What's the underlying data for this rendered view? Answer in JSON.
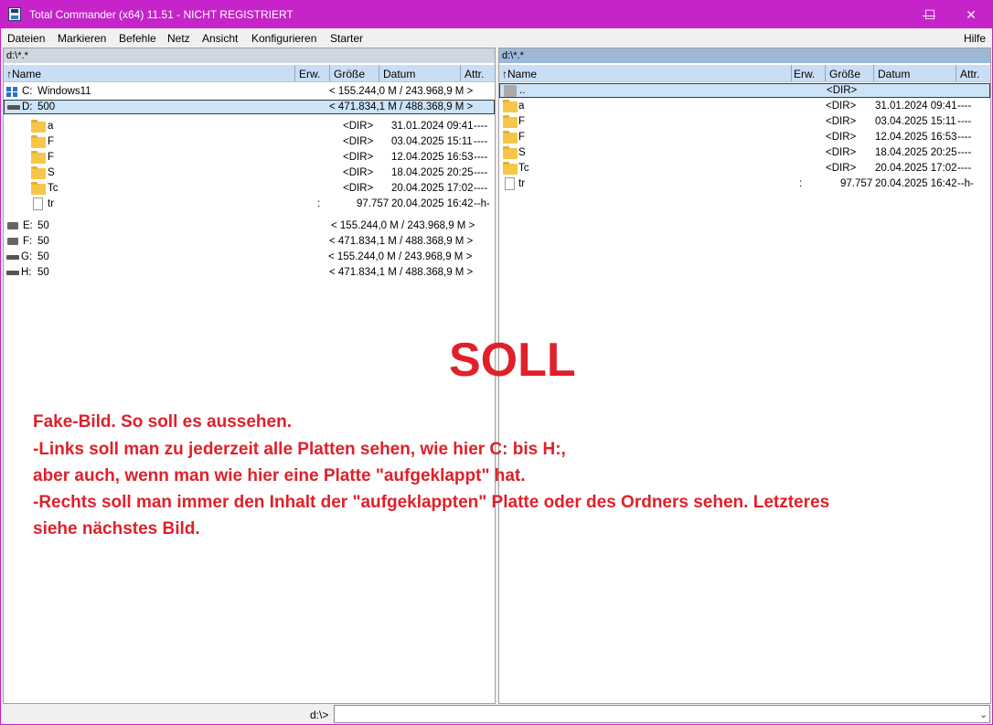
{
  "window": {
    "title": "Total Commander (x64) 11.51 - NICHT REGISTRIERT"
  },
  "titlebar": {
    "minimize": "—",
    "maximize": "☐",
    "close": "✕"
  },
  "menu": [
    "Dateien",
    "Markieren",
    "Befehle",
    "Netz",
    "Ansicht",
    "Konfigurieren",
    "Starter"
  ],
  "menu_help": "Hilfe",
  "left": {
    "path": "d:\\*.*",
    "headers": {
      "name": "↑Name",
      "ext": "Erw.",
      "size": "Größe",
      "date": "Datum",
      "attr": "Attr."
    },
    "drives": [
      {
        "letter": "C:",
        "label": "Windows11",
        "size": "< 155.244,0 M / 243.968,9 M >"
      },
      {
        "letter": "D:",
        "label": "500",
        "size": "< 471.834,1 M / 488.368,9 M >"
      }
    ],
    "files": [
      {
        "name": "a",
        "size": "<DIR>",
        "date": "31.01.2024 09:41",
        "attr": "----"
      },
      {
        "name": "F",
        "size": "<DIR>",
        "date": "03.04.2025 15:11",
        "attr": "----"
      },
      {
        "name": "F",
        "size": "<DIR>",
        "date": "12.04.2025 16:53",
        "attr": "----"
      },
      {
        "name": "S",
        "size": "<DIR>",
        "date": "18.04.2025 20:25",
        "attr": "----"
      },
      {
        "name": "Tc",
        "size": "<DIR>",
        "date": "20.04.2025 17:02",
        "attr": "----"
      },
      {
        "name": "tr",
        "ext": ":",
        "size": "97.757",
        "date": "20.04.2025 16:42",
        "attr": "--h-"
      }
    ],
    "drives2": [
      {
        "letter": "E:",
        "label": "50",
        "size": "< 155.244,0 M / 243.968,9 M >"
      },
      {
        "letter": "F:",
        "label": "50",
        "size": "< 471.834,1 M / 488.368,9 M >"
      },
      {
        "letter": "G:",
        "label": "50",
        "size": "< 155.244,0 M / 243.968,9 M >"
      },
      {
        "letter": "H:",
        "label": "50",
        "size": "< 471.834,1 M / 488.368,9 M >"
      }
    ]
  },
  "right": {
    "path": "d:\\*.*",
    "headers": {
      "name": "↑Name",
      "ext": "Erw.",
      "size": "Größe",
      "date": "Datum",
      "attr": "Attr."
    },
    "up": {
      "name": "..",
      "size": "<DIR>"
    },
    "files": [
      {
        "name": "a",
        "size": "<DIR>",
        "date": "31.01.2024 09:41",
        "attr": "----"
      },
      {
        "name": "F",
        "size": "<DIR>",
        "date": "03.04.2025 15:11",
        "attr": "----"
      },
      {
        "name": "F",
        "size": "<DIR>",
        "date": "12.04.2025 16:53",
        "attr": "----"
      },
      {
        "name": "S",
        "size": "<DIR>",
        "date": "18.04.2025 20:25",
        "attr": "----"
      },
      {
        "name": "Tc",
        "size": "<DIR>",
        "date": "20.04.2025 17:02",
        "attr": "----"
      },
      {
        "name": "tr",
        "ext": ":",
        "size": "97.757",
        "date": "20.04.2025 16:42",
        "attr": "--h-"
      }
    ]
  },
  "overlay": {
    "soll": "SOLL",
    "lines": [
      "Fake-Bild. So soll es aussehen.",
      "-Links soll man zu jederzeit alle Platten sehen, wie hier C: bis H:,",
      "aber auch, wenn man wie hier eine Platte \"aufgeklappt\" hat.",
      "-Rechts soll man immer den Inhalt der \"aufgeklappten\" Platte oder des Ordners sehen. Letzteres",
      "siehe nächstes Bild."
    ]
  },
  "commandline": {
    "label": "d:\\>",
    "value": ""
  },
  "colors": {
    "titlebar": "#c424c8",
    "annotation": "#e0202a",
    "header": "#c9def5"
  }
}
